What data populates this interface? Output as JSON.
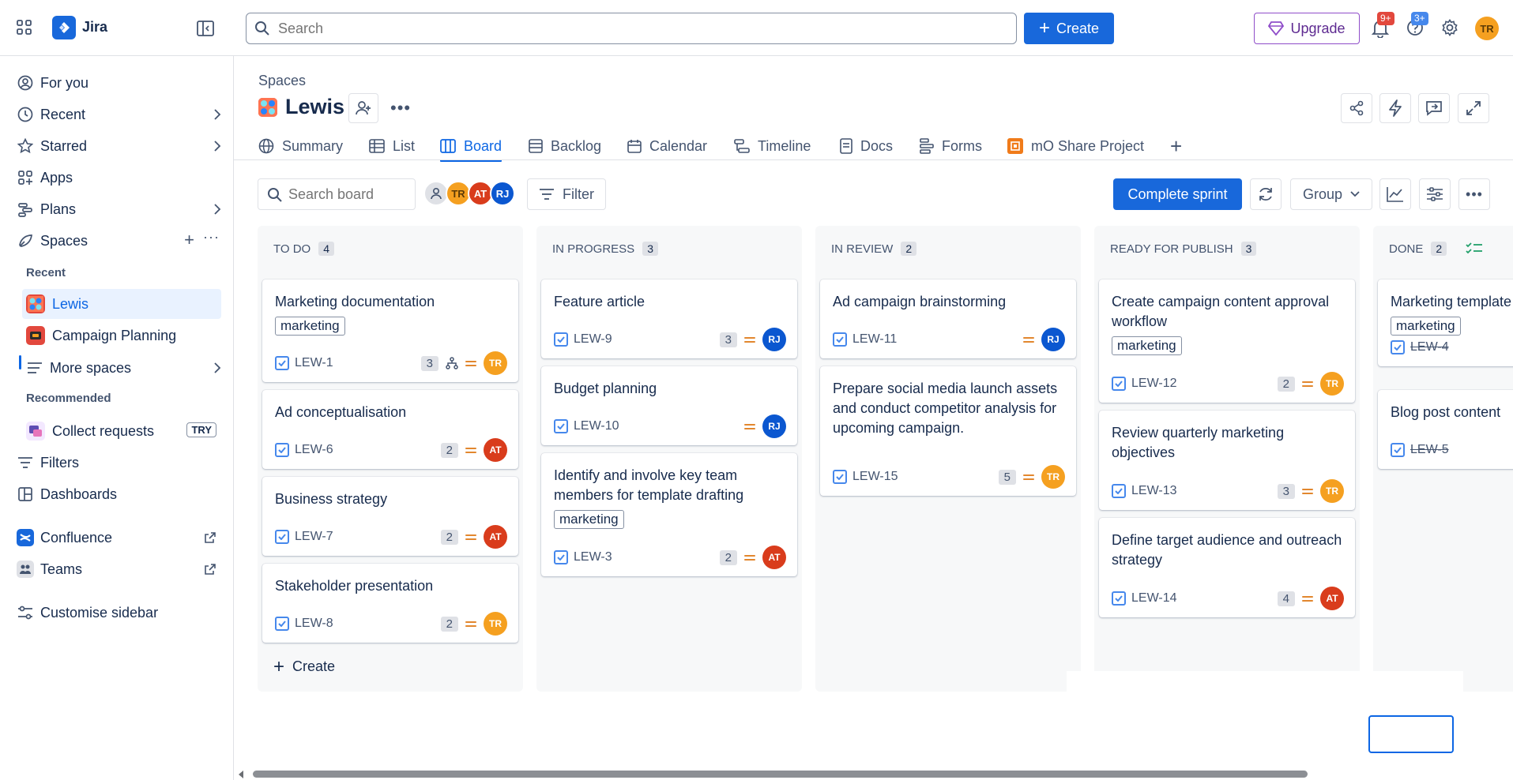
{
  "topbar": {
    "app_name": "Jira",
    "search_placeholder": "Search",
    "create_label": "Create",
    "upgrade_label": "Upgrade",
    "notif_badge": "9+",
    "help_badge": "3+",
    "avatar_initials": "TR"
  },
  "sidebar": {
    "for_you": "For you",
    "recent": "Recent",
    "starred": "Starred",
    "apps": "Apps",
    "plans": "Plans",
    "spaces": "Spaces",
    "recent_heading": "Recent",
    "space_lewis": "Lewis",
    "space_campaign": "Campaign Planning",
    "more_spaces": "More spaces",
    "recommended_heading": "Recommended",
    "collect_requests": "Collect requests",
    "try_badge": "TRY",
    "filters": "Filters",
    "dashboards": "Dashboards",
    "confluence": "Confluence",
    "teams": "Teams",
    "customise": "Customise sidebar"
  },
  "header": {
    "breadcrumb": "Spaces",
    "project_title": "Lewis"
  },
  "tabs": [
    "Summary",
    "List",
    "Board",
    "Backlog",
    "Calendar",
    "Timeline",
    "Docs",
    "Forms",
    "mO Share Project"
  ],
  "board_toolbar": {
    "search_placeholder": "Search board",
    "avatars": [
      "TR",
      "AT",
      "RJ"
    ],
    "filter_label": "Filter",
    "complete_sprint": "Complete sprint",
    "group_label": "Group"
  },
  "columns": [
    {
      "title": "TO DO",
      "count": "4",
      "cards": [
        {
          "title": "Marketing documentation",
          "label": "marketing",
          "key": "LEW-1",
          "points": "3",
          "subtasks": true,
          "assignee": "TR"
        },
        {
          "title": "Ad conceptualisation",
          "key": "LEW-6",
          "points": "2",
          "assignee": "AT"
        },
        {
          "title": "Business strategy",
          "key": "LEW-7",
          "points": "2",
          "assignee": "AT"
        },
        {
          "title": "Stakeholder presentation",
          "key": "LEW-8",
          "points": "2",
          "assignee": "TR"
        }
      ],
      "create_label": "Create"
    },
    {
      "title": "IN PROGRESS",
      "count": "3",
      "cards": [
        {
          "title": "Feature article",
          "key": "LEW-9",
          "points": "3",
          "assignee": "RJ"
        },
        {
          "title": "Budget planning",
          "key": "LEW-10",
          "assignee": "RJ"
        },
        {
          "title": "Identify and involve key team members for template drafting",
          "label": "marketing",
          "key": "LEW-3",
          "points": "2",
          "assignee": "AT"
        }
      ]
    },
    {
      "title": "IN REVIEW",
      "count": "2",
      "cards": [
        {
          "title": "Ad campaign brainstorming",
          "key": "LEW-11",
          "assignee": "RJ"
        },
        {
          "title": "Prepare social media launch assets and conduct competitor analysis for upcoming campaign.",
          "key": "LEW-15",
          "points": "5",
          "assignee": "TR"
        }
      ]
    },
    {
      "title": "READY FOR PUBLISH",
      "count": "3",
      "cards": [
        {
          "title": "Create campaign content approval workflow",
          "label": "marketing",
          "key": "LEW-12",
          "points": "2",
          "assignee": "TR"
        },
        {
          "title": "Review quarterly marketing objectives",
          "key": "LEW-13",
          "points": "3",
          "assignee": "TR"
        },
        {
          "title": "Define target audience and outreach strategy",
          "key": "LEW-14",
          "points": "4",
          "assignee": "AT"
        }
      ]
    },
    {
      "title": "DONE",
      "count": "2",
      "cards": [
        {
          "title": "Marketing template",
          "label": "marketing",
          "key": "LEW-4"
        },
        {
          "title": "Blog post content",
          "key": "LEW-5"
        }
      ]
    }
  ],
  "colors": {
    "brand": "#1868db",
    "tr_avatar": "#f5a020",
    "at_avatar": "#d93c1c",
    "rj_avatar": "#0b57d0",
    "priority": "#e2872e"
  }
}
